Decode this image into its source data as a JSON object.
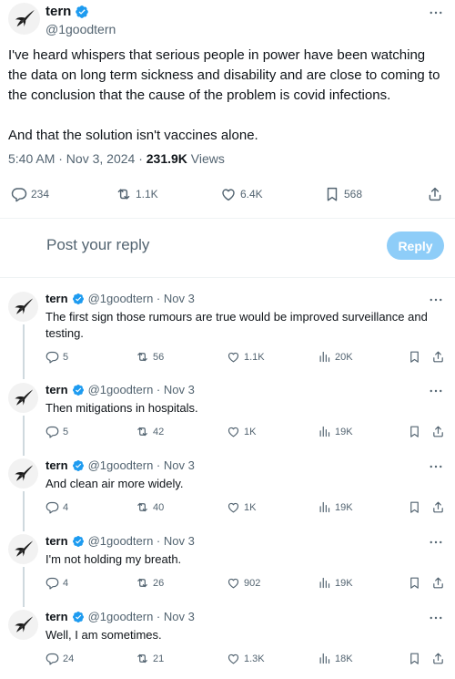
{
  "main_tweet": {
    "author_name": "tern",
    "author_handle": "@1goodtern",
    "paragraph_1": "I've heard whispers that serious people in power have been watching the data on long term sickness and disability and are close to coming to the conclusion that the cause of the problem is covid infections.",
    "paragraph_2": "And that the solution isn't vaccines alone.",
    "timestamp": "5:40 AM · Nov 3, 2024 · ",
    "views_count": "231.9K",
    "views_label": " Views",
    "stats": {
      "replies": "234",
      "reposts": "1.1K",
      "likes": "6.4K",
      "bookmarks": "568"
    }
  },
  "composer": {
    "placeholder": "Post your reply",
    "button_label": "Reply"
  },
  "replies": [
    {
      "name": "tern",
      "meta": "@1goodtern · Nov 3",
      "text": "The first sign those rumours are true would be improved surveillance and testing.",
      "replies": "5",
      "reposts": "56",
      "likes": "1.1K",
      "views": "20K"
    },
    {
      "name": "tern",
      "meta": "@1goodtern · Nov 3",
      "text": "Then mitigations in hospitals.",
      "replies": "5",
      "reposts": "42",
      "likes": "1K",
      "views": "19K"
    },
    {
      "name": "tern",
      "meta": "@1goodtern · Nov 3",
      "text": "And clean air more widely.",
      "replies": "4",
      "reposts": "40",
      "likes": "1K",
      "views": "19K"
    },
    {
      "name": "tern",
      "meta": "@1goodtern · Nov 3",
      "text": "I'm not holding my breath.",
      "replies": "4",
      "reposts": "26",
      "likes": "902",
      "views": "19K"
    },
    {
      "name": "tern",
      "meta": "@1goodtern · Nov 3",
      "text": "Well, I am sometimes.",
      "replies": "24",
      "reposts": "21",
      "likes": "1.3K",
      "views": "18K"
    }
  ],
  "icons": {
    "verified": "verified-badge-icon",
    "more": "more-options-icon",
    "reply": "reply-icon",
    "repost": "repost-icon",
    "like": "like-icon",
    "bookmark": "bookmark-icon",
    "share": "share-icon",
    "views": "views-icon"
  },
  "colors": {
    "verified": "#1d9bf0",
    "reply_button": "#8ecdf8",
    "secondary_text": "#536471"
  }
}
